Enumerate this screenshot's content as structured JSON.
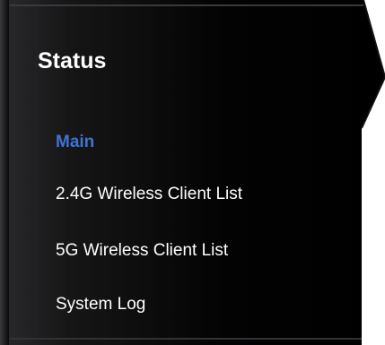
{
  "theme": {
    "panel_dark": "#050506",
    "panel_mid": "#202023",
    "active_link": "#3f73d6",
    "text": "#ffffff"
  },
  "menu": {
    "title": "Status",
    "items": [
      {
        "label": "Main",
        "active": true
      },
      {
        "label": "2.4G Wireless Client List",
        "active": false
      },
      {
        "label": "5G Wireless Client List",
        "active": false
      },
      {
        "label": "System Log",
        "active": false
      }
    ]
  }
}
